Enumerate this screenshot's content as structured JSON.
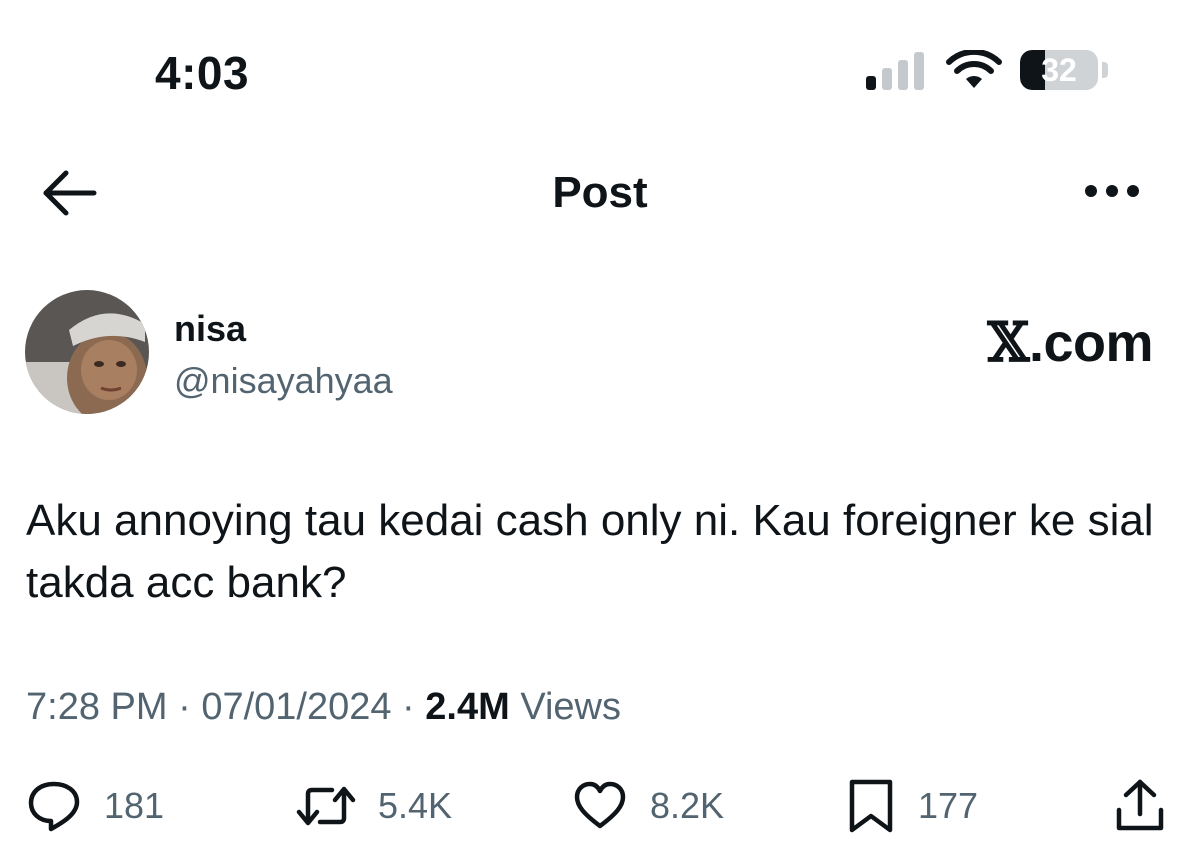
{
  "status_bar": {
    "time": "4:03",
    "battery_level": "32",
    "battery_fraction": 0.32,
    "signal_icon": "cellular-signal-icon",
    "wifi_icon": "wifi-icon"
  },
  "header": {
    "title": "Post",
    "back_icon": "arrow-left-icon",
    "more_icon": "more-dots-icon"
  },
  "author": {
    "name": "nisa",
    "handle": "@nisayahyaa"
  },
  "brand": {
    "x_mark": "𝕏",
    "suffix": ".com"
  },
  "post": {
    "text": "Aku annoying tau kedai cash only ni. Kau foreigner ke sial takda acc bank?",
    "time": "7:28 PM",
    "separator": " · ",
    "date": "07/01/2024",
    "views_count": "2.4M",
    "views_label": " Views"
  },
  "actions": {
    "replies": "181",
    "reposts": "5.4K",
    "likes": "8.2K",
    "bookmarks": "177"
  },
  "colors": {
    "text_primary": "#0f1419",
    "text_secondary": "#536471",
    "background": "#ffffff"
  }
}
